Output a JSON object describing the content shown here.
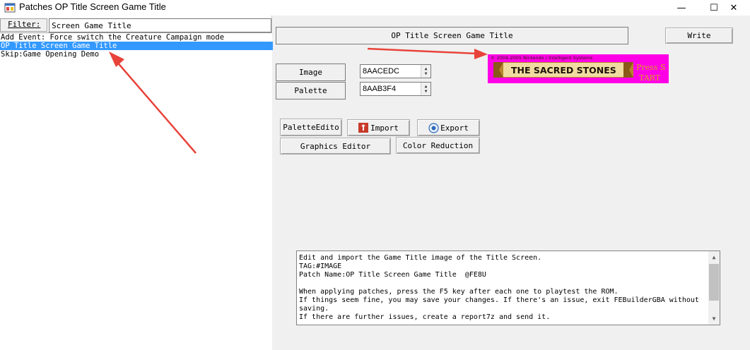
{
  "window": {
    "title": "Patches OP Title Screen Game Title",
    "minimize": "—",
    "maximize": "☐",
    "close": "✕",
    "icon": "app-window-icon"
  },
  "filter": {
    "label": "Filter:",
    "value": "Screen Game Title"
  },
  "patch_list": {
    "items": [
      "Add Event: Force switch the Creature Campaign mode",
      "OP Title Screen Game Title",
      "Skip:Game Opening Demo"
    ],
    "selected_index": 1
  },
  "patch": {
    "title": "OP Title Screen Game Title",
    "write_label": "Write",
    "image_label": "Image",
    "image_address": "8AACEDC",
    "palette_label": "Palette",
    "palette_address": "8AAB3F4",
    "palette_editor_label": "PaletteEdito",
    "import_label": "Import",
    "export_label": "Export",
    "graphics_editor_label": "Graphics Editor",
    "color_reduction_label": "Color Reduction"
  },
  "preview": {
    "copyright_line": "© 2004-2005 Nintendo / Intelligent Systems",
    "banner_text": "THE SACRED STONES",
    "side_line1": "Press S",
    "side_line2": "TART",
    "bg_color": "#ff00e6"
  },
  "description": {
    "lines": [
      "Edit and import the Game Title image of the Title Screen.",
      "TAG:#IMAGE",
      "Patch Name:OP Title Screen Game Title  @FE8U",
      "",
      "When applying patches, press the F5 key after each one to playtest the ROM.",
      "If things seem fine, you may save your changes. If there's an issue, exit FEBuilderGBA without",
      "saving.",
      "If there are further issues, create a report7z and send it."
    ]
  },
  "colors": {
    "selection": "#3399ff",
    "annotation_arrow": "#e8433a"
  }
}
